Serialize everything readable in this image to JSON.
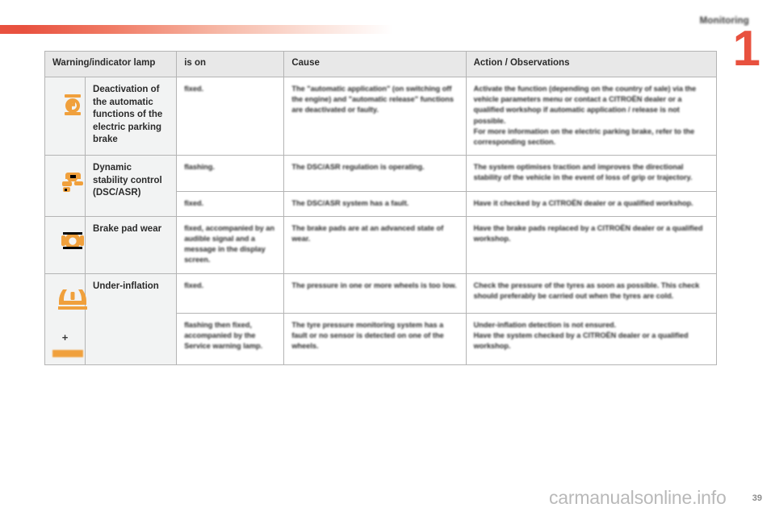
{
  "page": {
    "chapter_title": "Monitoring",
    "chapter_number": "1",
    "page_number": "39",
    "watermark": "carmanualsonline.info",
    "accent_color": "#e8513f",
    "lamp_color": "#f0a03c"
  },
  "table": {
    "headers": {
      "icon": "",
      "lamp": "Warning/indicator lamp",
      "is_on": "is on",
      "cause": "Cause",
      "action": "Action / Observations"
    },
    "rows": [
      {
        "icon_name": "parking-brake-auto-deactivation-icon",
        "lamp": "Deactivation of the automatic functions of the electric parking brake",
        "is_on": "fixed.",
        "cause": "The \"automatic application\" (on switching off the engine) and \"automatic release\" functions are deactivated or faulty.",
        "action": "Activate the function (depending on the country of sale) via the vehicle parameters menu or contact a CITROËN dealer or a qualified workshop if automatic application / release is not possible.\nFor more information on the electric parking brake, refer to the corresponding section."
      },
      {
        "icon_name": "dynamic-stability-control-icon",
        "lamp": "Dynamic stability control (DSC/ASR)",
        "is_on": "flashing.",
        "cause": "The DSC/ASR regulation is operating.",
        "action": "The system optimises traction and improves the directional stability of the vehicle in the event of loss of grip or trajectory."
      },
      {
        "icon_name": "dynamic-stability-control-icon",
        "lamp": "",
        "is_on": "fixed.",
        "cause": "The DSC/ASR system has a fault.",
        "action": "Have it checked by a CITROËN dealer or a qualified workshop."
      },
      {
        "icon_name": "brake-pad-wear-icon",
        "lamp": "Brake pad wear",
        "is_on": "fixed, accompanied by an audible signal and a message in the display screen.",
        "cause": "The brake pads are at an advanced state of wear.",
        "action": "Have the brake pads replaced by a CITROËN dealer or a qualified workshop."
      },
      {
        "icon_name": "tyre-under-inflation-icon",
        "lamp": "Under-inflation",
        "is_on": "fixed.",
        "cause": "The pressure in one or more wheels is too low.",
        "action": "Check the pressure of the tyres as soon as possible. This check should preferably be carried out when the tyres are cold."
      },
      {
        "icon_name": "tyre-under-inflation-plus-service-icon",
        "lamp": "",
        "is_on": "flashing then fixed, accompanied by the Service warning lamp.",
        "cause": "The tyre pressure monitoring system has a fault or no sensor is detected on one of the wheels.",
        "action": "Under-inflation detection is not ensured.\nHave the system checked by a CITROËN dealer or a qualified workshop."
      }
    ],
    "plus_symbol": "+"
  }
}
